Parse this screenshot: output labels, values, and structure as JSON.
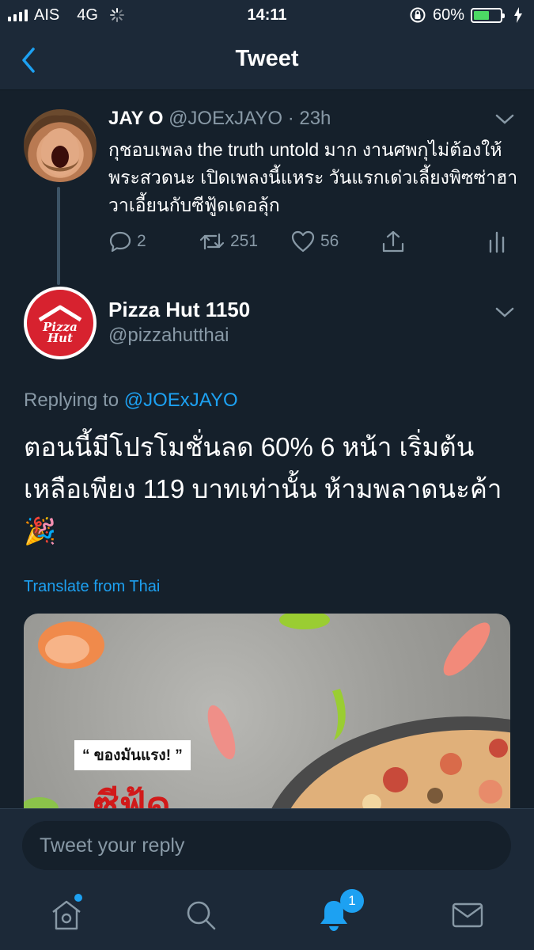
{
  "status_bar": {
    "carrier": "AIS",
    "network": "4G",
    "time": "14:11",
    "battery": "60%"
  },
  "header": {
    "title": "Tweet"
  },
  "tweet1": {
    "name": "JAY O",
    "handle": "@JOExJAYO",
    "time": "· 23h",
    "text": "กุชอบเพลง the truth untold มาก งานศพกุไม่ต้องให้พระสวดนะ เปิดเพลงนี้แหระ วันแรกเด่วเลี้ยงพิซซ่าฮาวาเอี้ยนกับซีฟู้ดเดอลุ้ก",
    "replies": "2",
    "retweets": "251",
    "likes": "56"
  },
  "tweet2": {
    "name": "Pizza Hut 1150",
    "handle": "@pizzahutthai",
    "replying_prefix": "Replying to",
    "replying_to": "@JOExJAYO",
    "text": "ตอนนี้มีโปรโมชั่นลด 60% 6 หน้า เริ่มต้นเหลือเพียง 119 บาทเท่านั้น ห้ามพลาดนะค้า 🎉",
    "translate": "Translate from Thai",
    "media": {
      "quote": "“ ของมันแรง! ”",
      "big_text": "ซีฟู้ด"
    },
    "logo_text": "Pizza Hut"
  },
  "reply": {
    "placeholder": "Tweet your reply"
  },
  "tabs": {
    "notifications_badge": "1"
  },
  "colors": {
    "background": "#15202b",
    "bar": "#1c2938",
    "accent": "#1da1f2",
    "secondary_text": "#8899a6"
  }
}
